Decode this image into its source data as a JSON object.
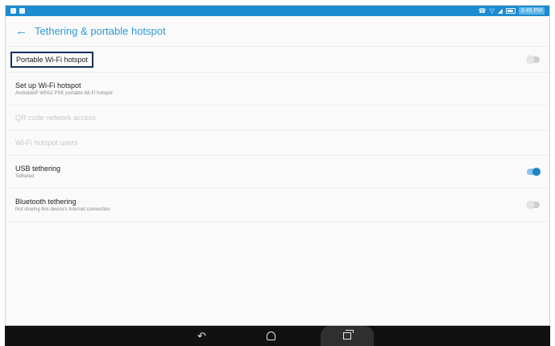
{
  "status_bar": {
    "time": "8:45 PM"
  },
  "header": {
    "title": "Tethering & portable hotspot",
    "back_icon": "back-arrow-icon"
  },
  "settings": [
    {
      "id": "portable-wifi-hotspot",
      "title": "Portable Wi-Fi hotspot",
      "subtitle": "",
      "toggle": "off",
      "enabled": true,
      "highlighted": true
    },
    {
      "id": "setup-wifi-hotspot",
      "title": "Set up Wi-Fi hotspot",
      "subtitle": "AndroidAP WPA2 PSK portable Wi-Fi hotspot",
      "toggle": null,
      "enabled": true
    },
    {
      "id": "qr-code-network-access",
      "title": "QR code network access",
      "subtitle": "",
      "toggle": null,
      "enabled": false
    },
    {
      "id": "wifi-hotspot-users",
      "title": "Wi-Fi hotspot users",
      "subtitle": "",
      "toggle": null,
      "enabled": false
    },
    {
      "id": "usb-tethering",
      "title": "USB tethering",
      "subtitle": "Tethered",
      "toggle": "on",
      "enabled": true
    },
    {
      "id": "bluetooth-tethering",
      "title": "Bluetooth tethering",
      "subtitle": "Not sharing this device's Internet connection",
      "toggle": "off",
      "enabled": true
    }
  ],
  "colors": {
    "accent": "#2e9bd6",
    "status_bar": "#1c8bd0",
    "toggle_on": "#1d85c8",
    "highlight_border": "#17305e"
  },
  "nav_bar": {
    "buttons": [
      "back-icon",
      "home-icon",
      "recent-apps-icon"
    ]
  }
}
